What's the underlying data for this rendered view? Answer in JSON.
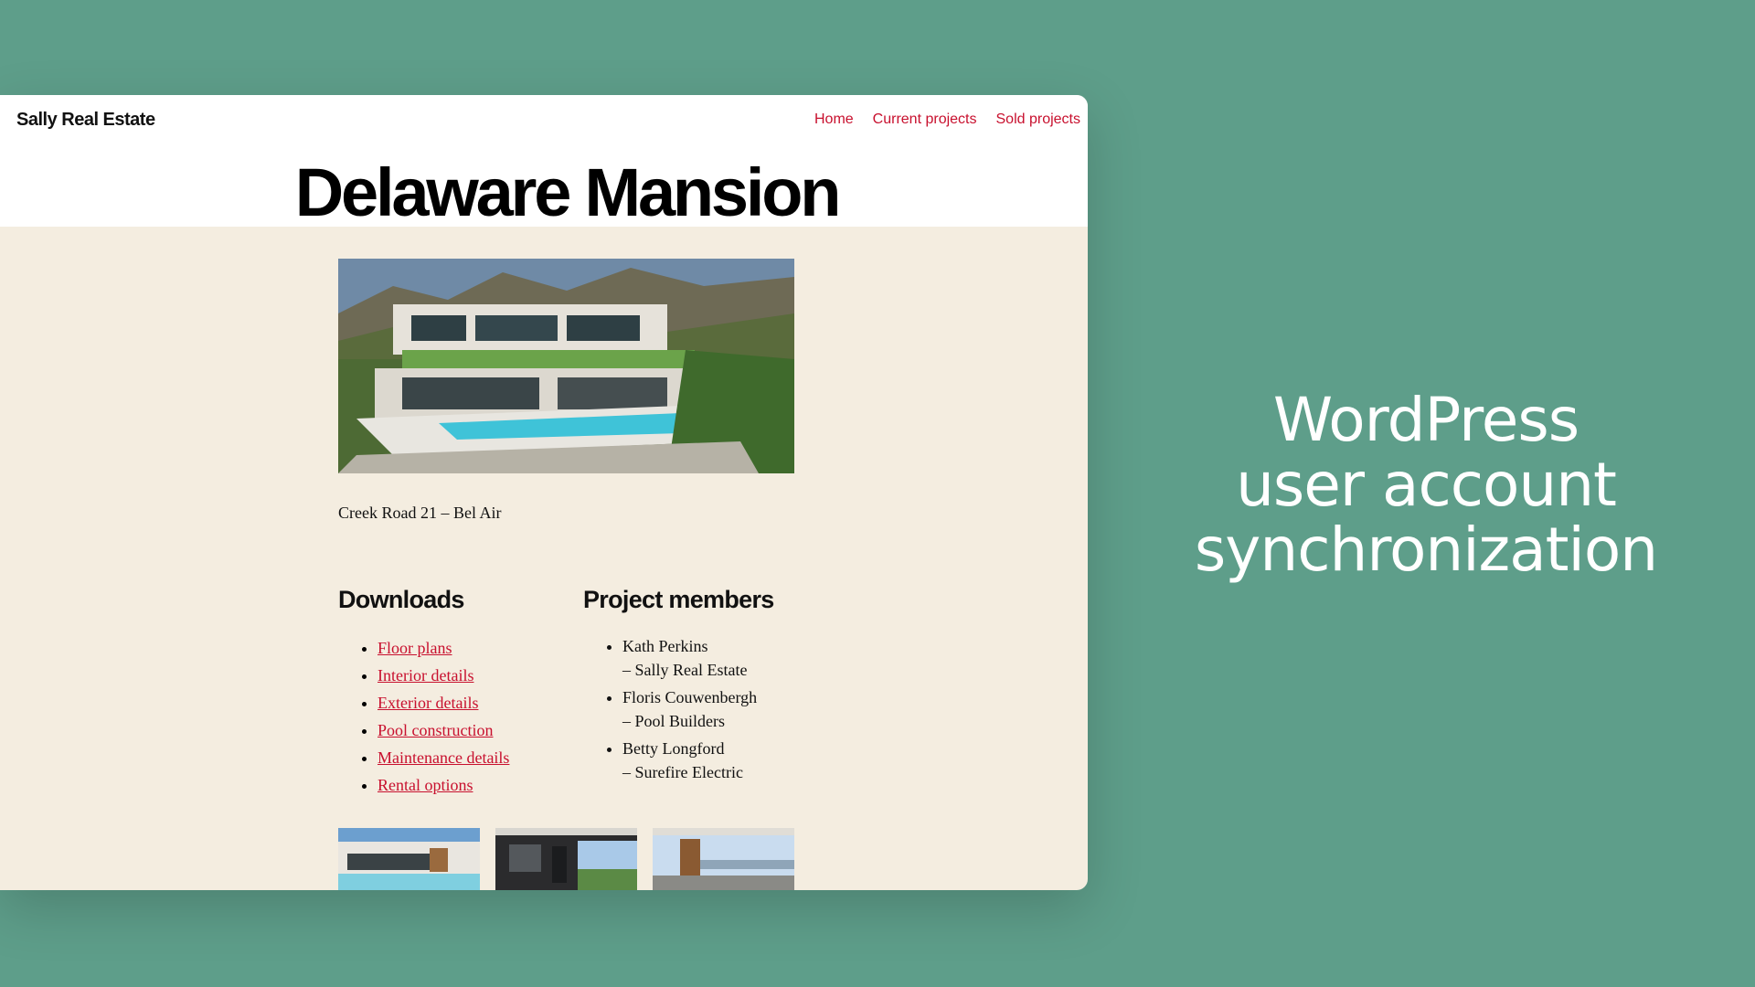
{
  "site": {
    "title": "Sally Real Estate",
    "nav": [
      "Home",
      "Current projects",
      "Sold projects"
    ]
  },
  "page": {
    "title": "Delaware Mansion",
    "address": "Creek Road 21 – Bel Air"
  },
  "downloads": {
    "heading": "Downloads",
    "items": [
      "Floor plans",
      "Interior details",
      "Exterior details",
      "Pool construction",
      "Maintenance details",
      "Rental options"
    ]
  },
  "members": {
    "heading": "Project members",
    "items": [
      {
        "name": "Kath Perkins",
        "company": "– Sally Real Estate"
      },
      {
        "name": "Floris Couwenbergh",
        "company": "– Pool Builders"
      },
      {
        "name": "Betty Longford",
        "company": "– Surefire Electric"
      }
    ]
  },
  "tagline": [
    "WordPress",
    "user account",
    "synchronization"
  ],
  "colors": {
    "background": "#5e9e8a",
    "content_bg": "#f4ede0",
    "accent": "#c8102e"
  }
}
